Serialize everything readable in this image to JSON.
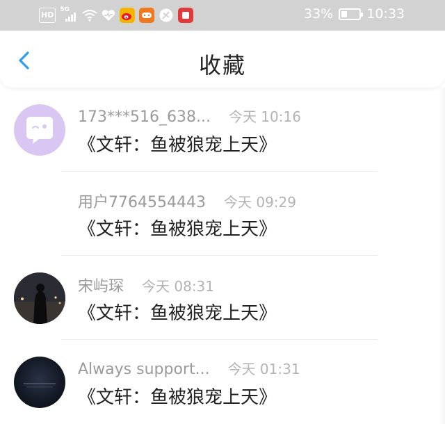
{
  "status_bar": {
    "hd_label": "HD",
    "network_label": "5G",
    "icons": [
      "hd-icon",
      "signal-5g-icon",
      "wifi-icon",
      "heart-icon",
      "weibo-icon",
      "game-app-icon",
      "browser-icon",
      "red-app-icon"
    ],
    "battery_percent": "33%",
    "battery_level": 0.33,
    "time": "10:33"
  },
  "nav": {
    "title": "收藏",
    "back_icon": "chevron-left-icon",
    "accent_color": "#2a9df4"
  },
  "items": [
    {
      "username": "173***516_638...",
      "time": "今天 10:16",
      "content": "《文轩：鱼被狼宠上天》",
      "avatar": "chat-bubble-avatar"
    },
    {
      "username": "用户7764554443",
      "time": "今天 09:29",
      "content": "《文轩：鱼被狼宠上天》",
      "avatar": ""
    },
    {
      "username": "宋屿琛",
      "time": "今天 08:31",
      "content": "《文轩：鱼被狼宠上天》",
      "avatar": "photo-avatar"
    },
    {
      "username": "Always support...",
      "time": "今天 01:31",
      "content": "《文轩：鱼被狼宠上天》",
      "avatar": "dark-photo-avatar"
    }
  ]
}
